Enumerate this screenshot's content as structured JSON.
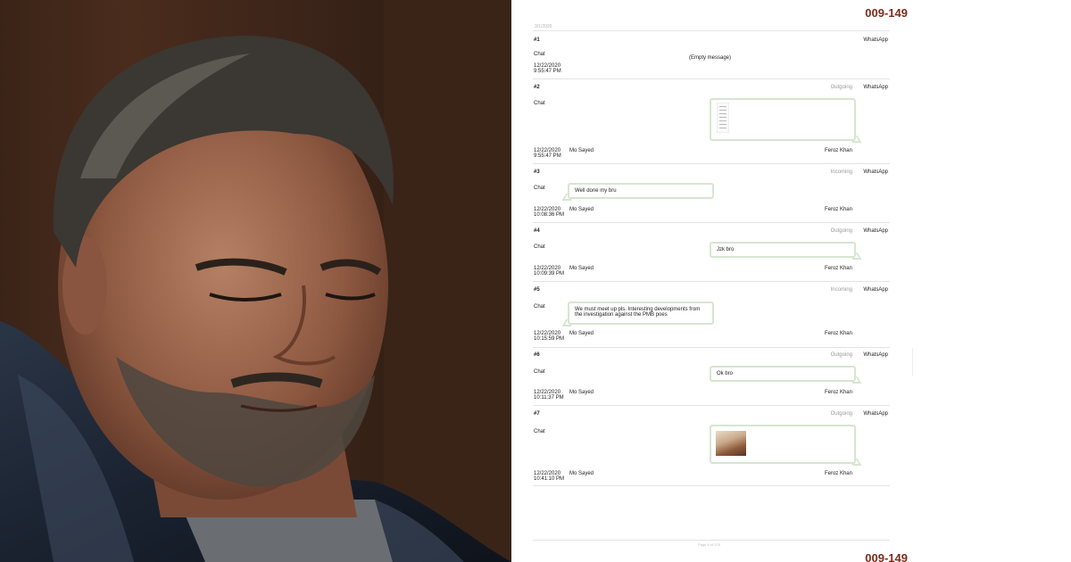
{
  "document": {
    "id_top": "009-149",
    "id_bottom": "009-149",
    "date_header": "3/1/2020",
    "footer": "Page 6 of 578"
  },
  "messages": [
    {
      "num": "#1",
      "app": "WhatsApp",
      "direction": "",
      "type": "Chat",
      "body": "(Empty message)",
      "date": "12/22/2020",
      "time": "9:55:47 PM",
      "sender": "",
      "recipient": ""
    },
    {
      "num": "#2",
      "app": "WhatsApp",
      "direction": "Outgoing",
      "type": "Chat",
      "body": "",
      "date": "12/22/2020",
      "time": "9:55:47 PM",
      "sender": "Mo Sayed",
      "recipient": "Feroz Khan"
    },
    {
      "num": "#3",
      "app": "WhatsApp",
      "direction": "Incoming",
      "type": "Chat",
      "body": "Well done my bru",
      "date": "12/22/2020",
      "time": "10:08:36 PM",
      "sender": "Mo Sayed",
      "recipient": "Feroz Khan"
    },
    {
      "num": "#4",
      "app": "WhatsApp",
      "direction": "Outgoing",
      "type": "Chat",
      "body": "Jzk bro",
      "date": "12/22/2020",
      "time": "10:09:39 PM",
      "sender": "Mo Sayed",
      "recipient": "Feroz Khan"
    },
    {
      "num": "#5",
      "app": "WhatsApp",
      "direction": "Incoming",
      "type": "Chat",
      "body": "We must meet up pls. Interesting developments from the investigation against the PMB poes",
      "date": "12/22/2020",
      "time": "10:15:59 PM",
      "sender": "Mo Sayed",
      "recipient": "Feroz Khan"
    },
    {
      "num": "#6",
      "app": "WhatsApp",
      "direction": "Outgoing",
      "type": "Chat",
      "body": "Ok bro",
      "date": "12/22/2020",
      "time": "10:11:37 PM",
      "sender": "Mo Sayed",
      "recipient": "Feroz Khan"
    },
    {
      "num": "#7",
      "app": "WhatsApp",
      "direction": "Outgoing",
      "type": "Chat",
      "body": "",
      "date": "12/22/2020",
      "time": "10:41:10 PM",
      "sender": "Mo Sayed",
      "recipient": "Feroz Khan"
    }
  ]
}
